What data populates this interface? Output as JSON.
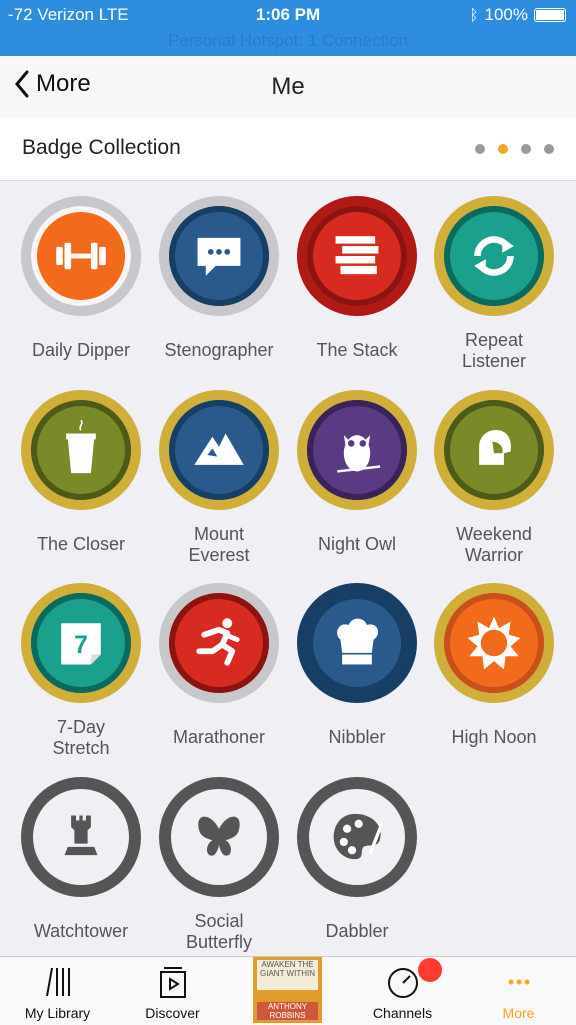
{
  "status_bar": {
    "carrier": "-72 Verizon  LTE",
    "time": "1:06 PM",
    "battery": "100%",
    "hotspot": "Personal Hotspot: 1 Connection"
  },
  "nav": {
    "back_label": "More",
    "title": "Me"
  },
  "section": {
    "title": "Badge Collection",
    "page_count": 4,
    "active_page": 2
  },
  "colors": {
    "accent": "#f5a623",
    "status_bar": "#2f8de0"
  },
  "badges": [
    {
      "label": "Daily Dipper",
      "icon": "dumbbell-icon"
    },
    {
      "label": "Stenographer",
      "icon": "chat-bubble-icon"
    },
    {
      "label": "The Stack",
      "icon": "book-stack-icon"
    },
    {
      "label": "Repeat\nListener",
      "icon": "repeat-icon"
    },
    {
      "label": "The Closer",
      "icon": "coffee-cup-icon"
    },
    {
      "label": "Mount\nEverest",
      "icon": "mountain-icon"
    },
    {
      "label": "Night Owl",
      "icon": "owl-icon"
    },
    {
      "label": "Weekend\nWarrior",
      "icon": "spartan-helmet-icon"
    },
    {
      "label": "7-Day\nStretch",
      "icon": "calendar-7-icon"
    },
    {
      "label": "Marathoner",
      "icon": "runner-icon"
    },
    {
      "label": "Nibbler",
      "icon": "chef-hat-icon"
    },
    {
      "label": "High Noon",
      "icon": "sun-icon"
    },
    {
      "label": "Watchtower",
      "icon": "rook-icon"
    },
    {
      "label": "Social\nButterfly",
      "icon": "butterfly-icon"
    },
    {
      "label": "Dabbler",
      "icon": "palette-icon"
    }
  ],
  "tabs": [
    {
      "label": "My Library",
      "icon": "library-icon"
    },
    {
      "label": "Discover",
      "icon": "discover-icon"
    },
    {
      "label": "",
      "icon": "now-playing-book"
    },
    {
      "label": "Channels",
      "icon": "channels-icon"
    },
    {
      "label": "More",
      "icon": "more-icon"
    }
  ],
  "now_playing": {
    "title": "AWAKEN THE GIANT WITHIN",
    "author": "ANTHONY ROBBINS"
  }
}
